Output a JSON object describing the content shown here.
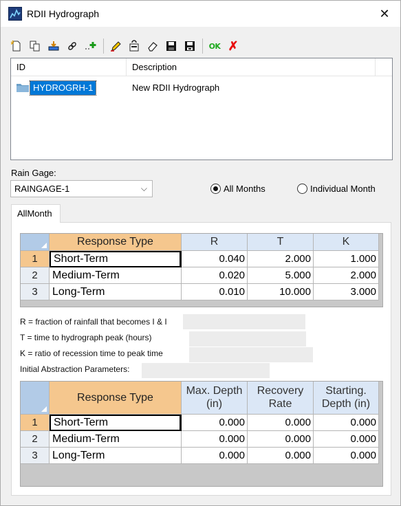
{
  "window": {
    "title": "RDII Hydrograph",
    "close_glyph": "✕"
  },
  "toolbar": {
    "buttons": [
      {
        "name": "new-icon"
      },
      {
        "name": "copy-icon"
      },
      {
        "name": "import-icon"
      },
      {
        "name": "link-icon"
      },
      {
        "name": "add-icon"
      },
      {
        "name": "edit-icon"
      },
      {
        "name": "paste-icon"
      },
      {
        "name": "eraser-icon"
      },
      {
        "name": "save-icon"
      },
      {
        "name": "save-as-icon"
      }
    ],
    "ok_label": "OK",
    "cancel_glyph": "✗"
  },
  "list": {
    "columns": [
      "ID",
      "Description"
    ],
    "rows": [
      {
        "id": "HYDROGRH-1",
        "description": "New RDII Hydrograph"
      }
    ]
  },
  "rain_gage": {
    "label": "Rain Gage:",
    "value": "RAINGAGE-1"
  },
  "months": {
    "all_label": "All Months",
    "individual_label": "Individual Month",
    "selected": "all"
  },
  "tab": {
    "label": "AllMonth"
  },
  "response_table": {
    "headers": [
      "Response Type",
      "R",
      "T",
      "K"
    ],
    "rows": [
      {
        "n": "1",
        "type": "Short-Term",
        "r": "0.040",
        "t": "2.000",
        "k": "1.000"
      },
      {
        "n": "2",
        "type": "Medium-Term",
        "r": "0.020",
        "t": "5.000",
        "k": "2.000"
      },
      {
        "n": "3",
        "type": "Long-Term",
        "r": "0.010",
        "t": "10.000",
        "k": "3.000"
      }
    ]
  },
  "notes": [
    "R = fraction of rainfall that becomes I & I",
    "T = time to hydrograph peak (hours)",
    "K = ratio of recession time to peak time",
    "Initial Abstraction Parameters:"
  ],
  "abstraction_table": {
    "headers": [
      "Response Type",
      "Max. Depth\n(in)",
      "Recovery\nRate",
      "Starting.\nDepth (in)"
    ],
    "rows": [
      {
        "n": "1",
        "type": "Short-Term",
        "max": "0.000",
        "rate": "0.000",
        "start": "0.000"
      },
      {
        "n": "2",
        "type": "Medium-Term",
        "max": "0.000",
        "rate": "0.000",
        "start": "0.000"
      },
      {
        "n": "3",
        "type": "Long-Term",
        "max": "0.000",
        "rate": "0.000",
        "start": "0.000"
      }
    ]
  }
}
